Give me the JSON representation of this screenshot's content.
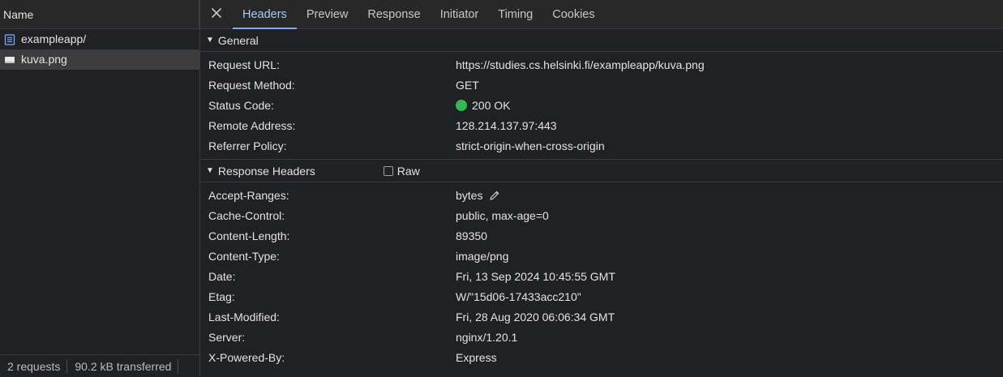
{
  "left": {
    "column_header": "Name",
    "files": [
      {
        "name": "exampleapp/",
        "icon": "document-icon",
        "selected": false
      },
      {
        "name": "kuva.png",
        "icon": "image-file-icon",
        "selected": true
      }
    ],
    "footer": {
      "requests": "2 requests",
      "transferred": "90.2 kB transferred"
    }
  },
  "tabs": {
    "close_icon": "close-icon",
    "items": [
      "Headers",
      "Preview",
      "Response",
      "Initiator",
      "Timing",
      "Cookies"
    ],
    "active": "Headers"
  },
  "general": {
    "title": "General",
    "rows": [
      {
        "key": "Request URL:",
        "value": "https://studies.cs.helsinki.fi/exampleapp/kuva.png"
      },
      {
        "key": "Request Method:",
        "value": "GET"
      },
      {
        "key": "Status Code:",
        "value": "200 OK",
        "status_color": "#2fbb4f"
      },
      {
        "key": "Remote Address:",
        "value": "128.214.137.97:443"
      },
      {
        "key": "Referrer Policy:",
        "value": "strict-origin-when-cross-origin"
      }
    ]
  },
  "response_headers": {
    "title": "Response Headers",
    "raw_label": "Raw",
    "raw_checked": false,
    "rows": [
      {
        "key": "Accept-Ranges:",
        "value": "bytes"
      },
      {
        "key": "Cache-Control:",
        "value": "public, max-age=0"
      },
      {
        "key": "Content-Length:",
        "value": "89350"
      },
      {
        "key": "Content-Type:",
        "value": "image/png"
      },
      {
        "key": "Date:",
        "value": "Fri, 13 Sep 2024 10:45:55 GMT"
      },
      {
        "key": "Etag:",
        "value": "W/\"15d06-17433acc210\""
      },
      {
        "key": "Last-Modified:",
        "value": "Fri, 28 Aug 2020 06:06:34 GMT"
      },
      {
        "key": "Server:",
        "value": "nginx/1.20.1"
      },
      {
        "key": "X-Powered-By:",
        "value": "Express"
      }
    ]
  },
  "colors": {
    "accent": "#a8c7fa",
    "tab_underline": "#7cacf8",
    "status_ok": "#2fbb4f",
    "background": "#202124"
  }
}
